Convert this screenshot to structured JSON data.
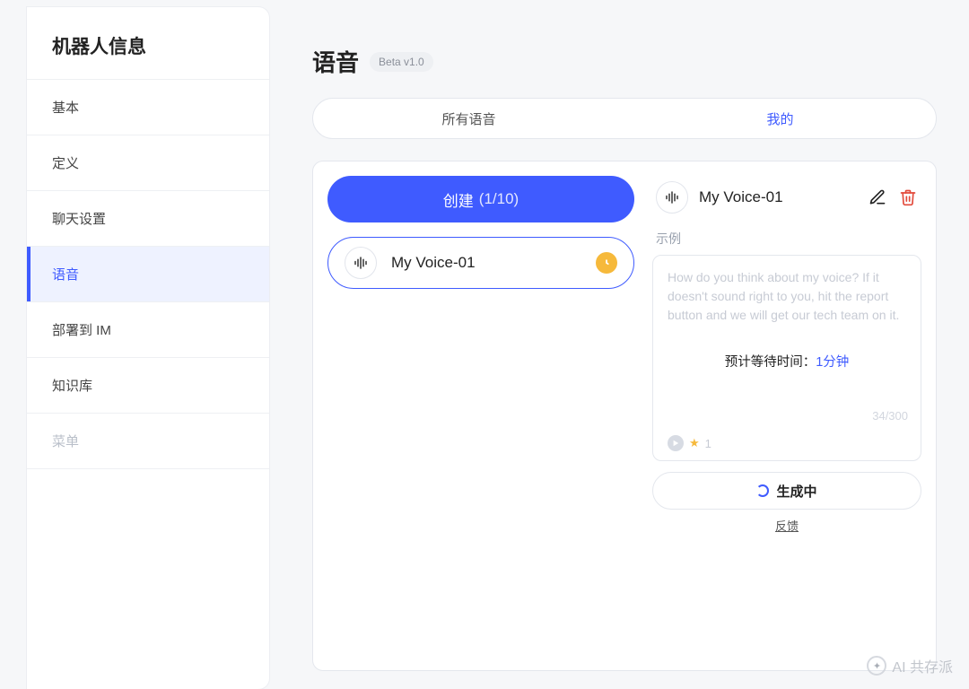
{
  "sidebar": {
    "title": "机器人信息",
    "items": [
      {
        "label": "基本"
      },
      {
        "label": "定义"
      },
      {
        "label": "聊天设置"
      },
      {
        "label": "语音",
        "active": true
      },
      {
        "label": "部署到 IM"
      },
      {
        "label": "知识库"
      },
      {
        "label": "菜单",
        "muted": true
      }
    ]
  },
  "page": {
    "title": "语音",
    "badge": "Beta v1.0"
  },
  "tabs": {
    "all": "所有语音",
    "mine": "我的"
  },
  "create": {
    "label": "创建",
    "count": "(1/10)"
  },
  "voices": [
    {
      "name": "My Voice-01",
      "pending": true
    }
  ],
  "detail": {
    "name": "My Voice-01",
    "section_label": "示例",
    "example_text": "How do you think about my voice? If it doesn't sound right to you, hit the report button and we will get our tech team on it.",
    "wait_label": "预计等待时间：",
    "wait_value": "1分钟",
    "counter": "34/300",
    "play_count": "1",
    "generate_label": "生成中",
    "feedback": "反馈"
  },
  "watermark": "AI 共存派"
}
